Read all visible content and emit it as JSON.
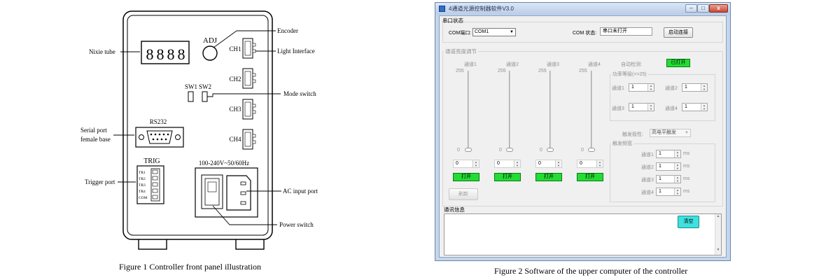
{
  "figure1": {
    "caption": "Figure 1 Controller front panel illustration",
    "display_digits": [
      "8",
      "8",
      "8",
      "8"
    ],
    "adj_label": "ADJ",
    "sw_labels": [
      "SW1",
      "SW2"
    ],
    "channel_labels": [
      "CH1",
      "CH2",
      "CH3",
      "CH4"
    ],
    "rs232_label": "RS232",
    "trig_label": "TRIG",
    "trig_pins": [
      "TR1",
      "TR2",
      "TR3",
      "TR4",
      "COM"
    ],
    "ac_label": "100-240V~50/60Hz",
    "callouts": {
      "nixie": "Nixie tube",
      "encoder": "Encoder",
      "light": "Light Interface",
      "mode": "Mode switch",
      "serial_1": "Serial port",
      "serial_2": "female base",
      "trigger": "Trigger port",
      "ac": "AC input port",
      "power": "Power switch"
    }
  },
  "figure2": {
    "caption": "Figure 2 Software of the upper computer of the controller",
    "window_title": "4通道光源控制器软件V3.0",
    "window_buttons": {
      "min": "–",
      "max": "□",
      "close": "x"
    },
    "serial": {
      "group_title": "串口状态",
      "port_label": "COM端口:",
      "port_value": "COM1",
      "status_label": "COM 状态:",
      "status_value": "串口未打开",
      "connect_button": "启动连接"
    },
    "channel_group_title": "通道亮度调节",
    "channels": [
      {
        "name": "通道1",
        "max": "255",
        "min": "0",
        "value": "0",
        "button": "打开"
      },
      {
        "name": "通道2",
        "max": "255",
        "min": "0",
        "value": "0",
        "button": "打开"
      },
      {
        "name": "通道3",
        "max": "255",
        "min": "0",
        "value": "0",
        "button": "打开"
      },
      {
        "name": "通道4",
        "max": "255",
        "min": "0",
        "value": "0",
        "button": "打开"
      }
    ],
    "refresh_button": "刷新",
    "auto_detect_label": "自动检测:",
    "auto_detect_state": "已打开",
    "power_group_title": "功率等级(<=25)",
    "power": [
      {
        "name": "通道1",
        "value": "1"
      },
      {
        "name": "通道2",
        "value": "1"
      },
      {
        "name": "通道3",
        "value": "1"
      },
      {
        "name": "通道4",
        "value": "1"
      }
    ],
    "trigger_polarity_label": "触发极性:",
    "trigger_polarity_value": "高电平触发",
    "trigger_group_title": "触发频宽",
    "trigger": [
      {
        "name": "通道1",
        "value": "1",
        "unit": "ms"
      },
      {
        "name": "通道2",
        "value": "1",
        "unit": "ms"
      },
      {
        "name": "通道3",
        "value": "1",
        "unit": "ms"
      },
      {
        "name": "通道4",
        "value": "1",
        "unit": "ms"
      }
    ],
    "message_group_title": "通讯信息",
    "clear_button": "清空"
  }
}
